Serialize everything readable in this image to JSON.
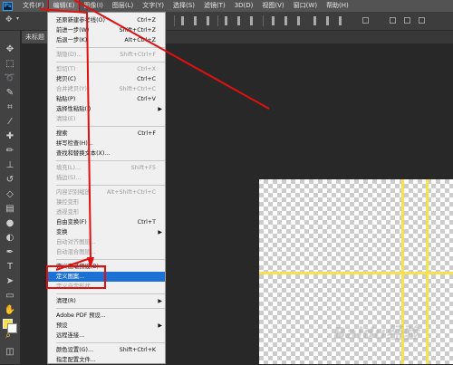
{
  "app": {
    "logo": "Ps",
    "menus": [
      "文件(F)",
      "编辑(E)",
      "图像(I)",
      "图层(L)",
      "文字(Y)",
      "选择(S)",
      "滤镜(T)",
      "3D(D)",
      "视图(V)",
      "窗口(W)",
      "帮助(H)"
    ],
    "active_menu_index": 1
  },
  "document": {
    "tab_label": "未标题"
  },
  "edit_menu": {
    "items": [
      {
        "label": "还原新建参考线(O)",
        "shortcut": "Ctrl+Z",
        "disabled": false
      },
      {
        "label": "前进一步(W)",
        "shortcut": "Shift+Ctrl+Z",
        "disabled": false
      },
      {
        "label": "后退一步(K)",
        "shortcut": "Alt+Ctrl+Z",
        "disabled": false
      },
      {
        "sep": true
      },
      {
        "label": "渐隐(D)...",
        "shortcut": "Shift+Ctrl+F",
        "disabled": true
      },
      {
        "sep": true
      },
      {
        "label": "剪切(T)",
        "shortcut": "Ctrl+X",
        "disabled": true
      },
      {
        "label": "拷贝(C)",
        "shortcut": "Ctrl+C",
        "disabled": false
      },
      {
        "label": "合并拷贝(Y)",
        "shortcut": "Shift+Ctrl+C",
        "disabled": true
      },
      {
        "label": "粘贴(P)",
        "shortcut": "Ctrl+V",
        "disabled": false
      },
      {
        "label": "选择性粘贴(I)",
        "shortcut": "",
        "disabled": false,
        "submenu": true
      },
      {
        "label": "清除(E)",
        "shortcut": "",
        "disabled": true
      },
      {
        "sep": true
      },
      {
        "label": "搜索",
        "shortcut": "Ctrl+F",
        "disabled": false
      },
      {
        "label": "拼写检查(H)...",
        "shortcut": "",
        "disabled": false
      },
      {
        "label": "查找和替换文本(X)...",
        "shortcut": "",
        "disabled": false
      },
      {
        "sep": true
      },
      {
        "label": "填充(L)...",
        "shortcut": "Shift+F5",
        "disabled": true
      },
      {
        "label": "描边(S)...",
        "shortcut": "",
        "disabled": true
      },
      {
        "sep": true
      },
      {
        "label": "内容识别缩放",
        "shortcut": "Alt+Shift+Ctrl+C",
        "disabled": true
      },
      {
        "label": "操控变形",
        "shortcut": "",
        "disabled": true
      },
      {
        "label": "透视变形",
        "shortcut": "",
        "disabled": true
      },
      {
        "label": "自由变换(F)",
        "shortcut": "Ctrl+T",
        "disabled": false
      },
      {
        "label": "变换",
        "shortcut": "",
        "disabled": false,
        "submenu": true
      },
      {
        "label": "自动对齐图层...",
        "shortcut": "",
        "disabled": true
      },
      {
        "label": "自动混合图层...",
        "shortcut": "",
        "disabled": true
      },
      {
        "sep": true
      },
      {
        "label": "定义画笔预设(B)...",
        "shortcut": "",
        "disabled": false
      },
      {
        "label": "定义图案...",
        "shortcut": "",
        "disabled": false,
        "highlighted": true
      },
      {
        "label": "定义自定形状...",
        "shortcut": "",
        "disabled": true
      },
      {
        "sep": true
      },
      {
        "label": "清理(R)",
        "shortcut": "",
        "disabled": false,
        "submenu": true
      },
      {
        "sep": true
      },
      {
        "label": "Adobe PDF 预设...",
        "shortcut": "",
        "disabled": false
      },
      {
        "label": "预设",
        "shortcut": "",
        "disabled": false,
        "submenu": true
      },
      {
        "label": "远程连接...",
        "shortcut": "",
        "disabled": false
      },
      {
        "sep": true
      },
      {
        "label": "颜色设置(G)...",
        "shortcut": "Shift+Ctrl+K",
        "disabled": false
      },
      {
        "label": "指定配置文件...",
        "shortcut": "",
        "disabled": false
      }
    ]
  },
  "watermark": "Baidu经验",
  "colors": {
    "guide": "#f6e24c",
    "highlight": "#1e71d4",
    "annotation": "#e01010"
  },
  "tool_icons": [
    "move-icon",
    "marquee-icon",
    "lasso-icon",
    "quick-select-icon",
    "crop-icon",
    "eyedropper-icon",
    "healing-icon",
    "brush-icon",
    "stamp-icon",
    "history-brush-icon",
    "eraser-icon",
    "gradient-icon",
    "blur-icon",
    "dodge-icon",
    "pen-icon",
    "type-icon",
    "path-select-icon",
    "shape-icon",
    "hand-icon",
    "zoom-icon",
    "edit-toolbar-icon"
  ]
}
